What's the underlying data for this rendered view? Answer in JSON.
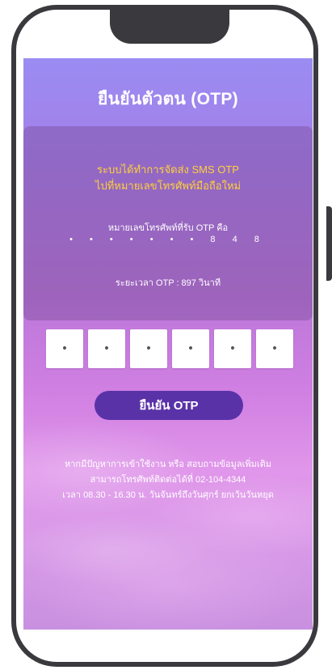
{
  "title": "ยืนยันตัวตน (OTP)",
  "sms_message": {
    "line1": "ระบบได้ทำการจัดส่ง SMS OTP",
    "line2": "ไปที่หมายเลขโทรศัพท์มือถือใหม่"
  },
  "phone_label": "หมายเลขโทรศัพท์ที่รับ OTP คือ",
  "phone_masked": "• • • • • • • 8 4 8",
  "timer_text": "ระยะเวลา OTP : 897 วินาที",
  "otp_fields": [
    "•",
    "•",
    "•",
    "•",
    "•",
    "•"
  ],
  "confirm_label": "ยืนยัน OTP",
  "help_text": {
    "line1": "หากมีปัญหาการเข้าใช้งาน หรือ สอบถามข้อมูลเพิ่มเติม",
    "line2": "สามารถโทรศัพท์ติดต่อได้ที่ 02-104-4344",
    "line3": "เวลา 08.30 - 16.30 น. วันจันทร์ถึงวันศุกร์ ยกเว้นวันหยุด"
  },
  "colors": {
    "accent": "#5a32a8",
    "sms_highlight": "#ffcf3a",
    "phone_frame": "#3a3a3e"
  }
}
